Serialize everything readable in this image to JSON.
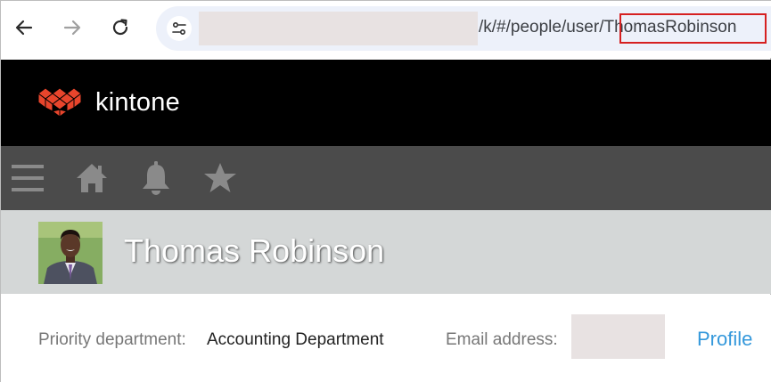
{
  "browser": {
    "url_visible": "/k/#/people/user/",
    "url_highlighted": "ThomasRobinson",
    "icons": [
      "back-arrow-icon",
      "forward-arrow-icon",
      "reload-icon",
      "site-info-icon"
    ]
  },
  "app": {
    "logo_text": "kintone",
    "brand_color": "#e8452c"
  },
  "toolbar": {
    "icons": [
      "menu-icon",
      "home-icon",
      "bell-icon",
      "star-icon"
    ]
  },
  "profile": {
    "name": "Thomas Robinson",
    "priority_department_label": "Priority department:",
    "priority_department_value": "Accounting Department",
    "email_label": "Email address:",
    "profile_link": "Profile"
  },
  "colors": {
    "header_bg": "#000000",
    "toolbar_bg": "#4b4b4b",
    "banner_bg": "#d4d7d7",
    "link": "#3498db",
    "highlight_border": "#d62020"
  }
}
